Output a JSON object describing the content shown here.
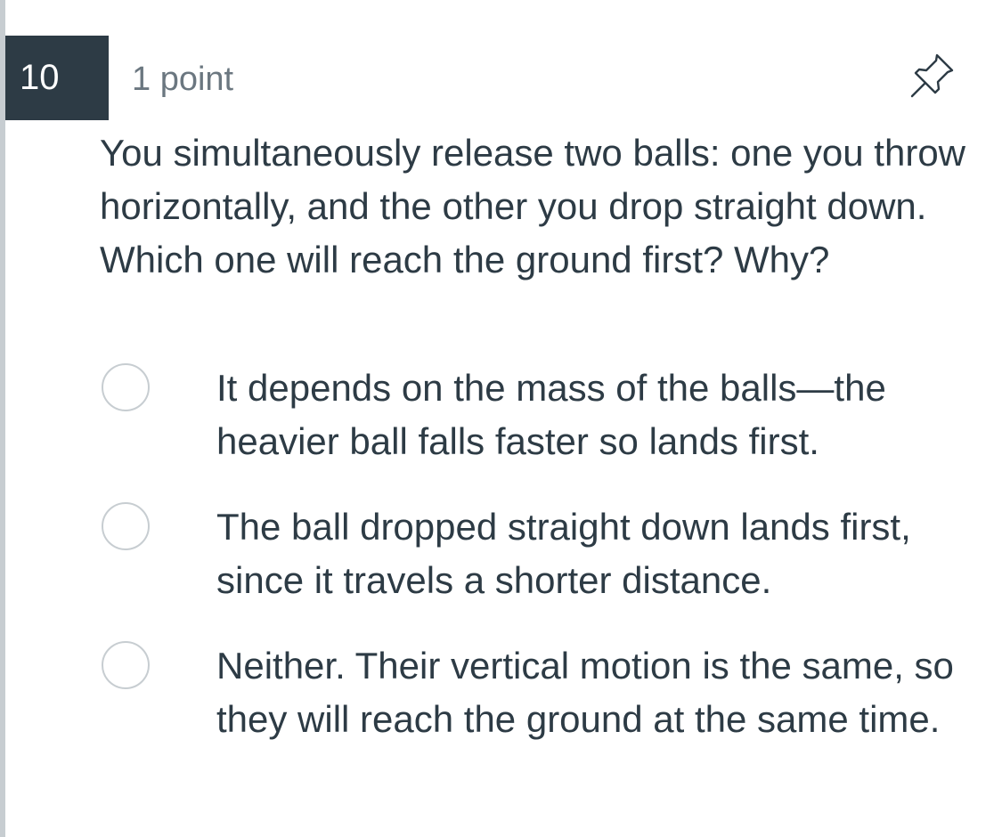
{
  "question": {
    "number": "10",
    "points": "1 point",
    "text": "You simultaneously release two balls: one you throw horizontally, and the other you drop straight down. Which one will reach the ground first? Why?"
  },
  "icons": {
    "pin": "pin-icon",
    "radio": "radio-unchecked"
  },
  "options": [
    {
      "text": "It depends on the mass of the balls—the heavier ball falls faster so lands first.",
      "selected": false
    },
    {
      "text": "The ball dropped straight down lands first, since it travels a shorter distance.",
      "selected": false
    },
    {
      "text": "Neither. Their vertical motion is the same, so they will reach the ground at the same time.",
      "selected": false
    }
  ],
  "colors": {
    "number_badge_bg": "#2d3b45",
    "text": "#2d3b45",
    "muted_text": "#6b7780",
    "radio_border": "#c7cdd1",
    "left_rule": "#c7cdd1"
  }
}
